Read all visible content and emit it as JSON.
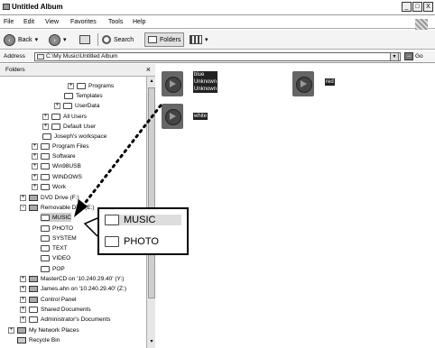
{
  "window": {
    "title": "Untitled Album",
    "controls": [
      "_",
      "□",
      "X"
    ]
  },
  "menu": [
    "File",
    "Edit",
    "View",
    "Favorites",
    "Tools",
    "Help"
  ],
  "toolbar": {
    "back": "Back",
    "search": "Search",
    "folders": "Folders"
  },
  "address": {
    "label": "Address",
    "value": "C:\\My Music\\Untitled Album",
    "go": "Go"
  },
  "folders_panel": {
    "title": "Folders",
    "close": "×",
    "items": [
      {
        "label": "Programs"
      },
      {
        "label": "Templates"
      },
      {
        "label": "UserData"
      },
      {
        "label": "All Users"
      },
      {
        "label": "Default User"
      },
      {
        "label": "Joseph's workspace"
      },
      {
        "label": "Program Files"
      },
      {
        "label": "Software"
      },
      {
        "label": "Win98USB"
      },
      {
        "label": "WINDOWS"
      },
      {
        "label": "Work"
      },
      {
        "label": "DVD Drive (F:)"
      },
      {
        "label": "Removable Disk (E:)"
      },
      {
        "label": "MUSIC"
      },
      {
        "label": "PHOTO"
      },
      {
        "label": "SYSTEM"
      },
      {
        "label": "TEXT"
      },
      {
        "label": "VIDEO"
      },
      {
        "label": "POP"
      },
      {
        "label": "MasterCD on '10.240.29.40' (Y:)"
      },
      {
        "label": "James.ahn on '10.240.29.40' (Z:)"
      },
      {
        "label": "Control Panel"
      },
      {
        "label": "Shared Documents"
      },
      {
        "label": "Administrator's Documents"
      },
      {
        "label": "My Network Places"
      },
      {
        "label": "Recycle Bin"
      }
    ]
  },
  "files": [
    {
      "name_lines": [
        "blue",
        "Unknown",
        "Unknown"
      ]
    },
    {
      "name_lines": [
        "red"
      ]
    },
    {
      "name_lines": [
        "white"
      ]
    }
  ],
  "callout": {
    "items": [
      "MUSIC",
      "PHOTO"
    ]
  }
}
